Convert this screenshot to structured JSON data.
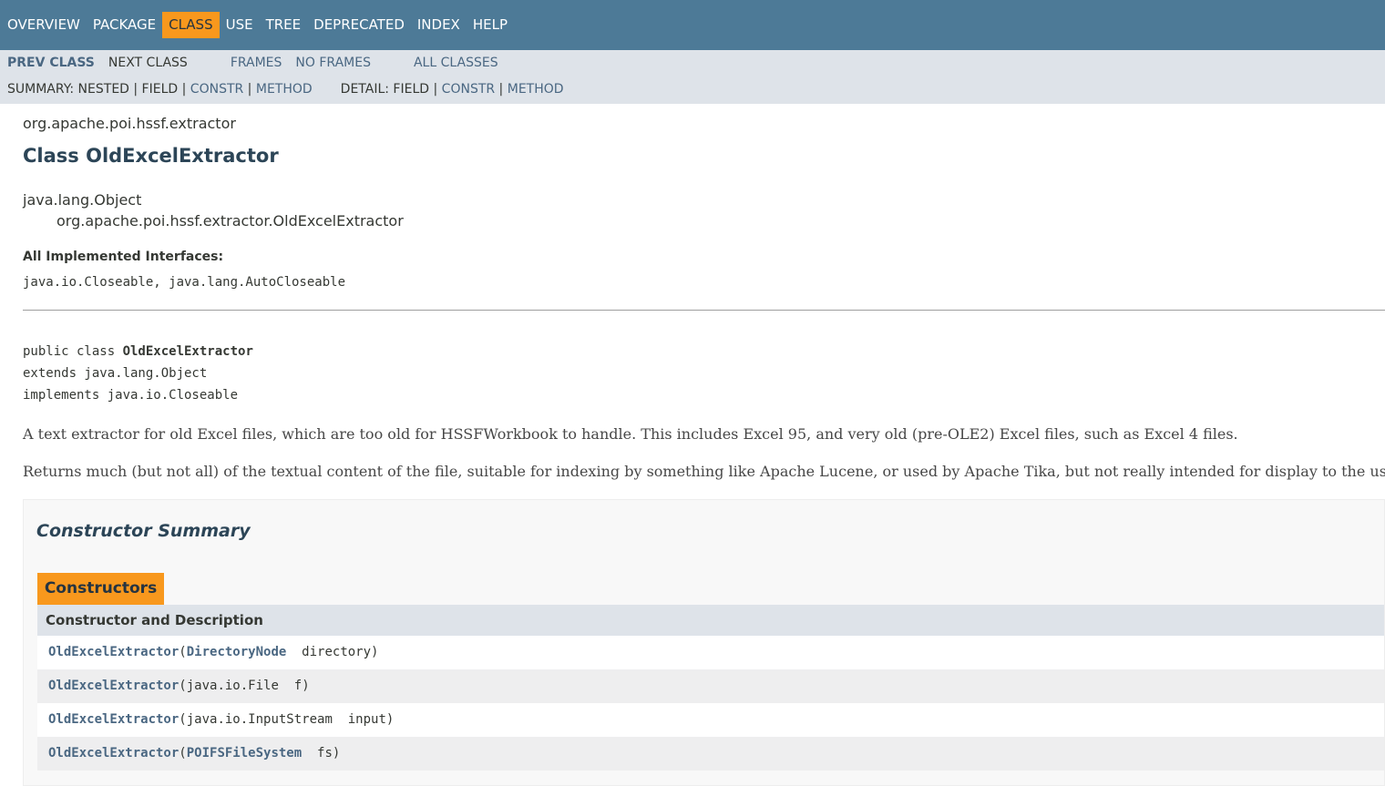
{
  "topnav": {
    "items": [
      {
        "label": "OVERVIEW",
        "active": false
      },
      {
        "label": "PACKAGE",
        "active": false
      },
      {
        "label": "CLASS",
        "active": true
      },
      {
        "label": "USE",
        "active": false
      },
      {
        "label": "TREE",
        "active": false
      },
      {
        "label": "DEPRECATED",
        "active": false
      },
      {
        "label": "INDEX",
        "active": false
      },
      {
        "label": "HELP",
        "active": false
      }
    ]
  },
  "subnav": {
    "prev_class": "PREV CLASS",
    "next_class": "NEXT CLASS",
    "frames": "FRAMES",
    "no_frames": "NO FRAMES",
    "all_classes": "ALL CLASSES",
    "summary_prefix": "SUMMARY: NESTED | FIELD | ",
    "summary_constr": "CONSTR",
    "summary_sep": " | ",
    "summary_method": "METHOD",
    "detail_prefix": "DETAIL: FIELD | ",
    "detail_constr": "CONSTR",
    "detail_sep": " | ",
    "detail_method": "METHOD"
  },
  "header": {
    "package": "org.apache.poi.hssf.extractor",
    "title": "Class OldExcelExtractor"
  },
  "inheritance": {
    "parent": "java.lang.Object",
    "child": "org.apache.poi.hssf.extractor.OldExcelExtractor"
  },
  "interfaces": {
    "label": "All Implemented Interfaces:",
    "list": "java.io.Closeable, java.lang.AutoCloseable"
  },
  "signature": {
    "line1_prefix": "public class ",
    "line1_class": "OldExcelExtractor",
    "line2": "extends java.lang.Object",
    "line3": "implements java.io.Closeable"
  },
  "description": {
    "p1": "A text extractor for old Excel files, which are too old for HSSFWorkbook to handle. This includes Excel 95, and very old (pre-OLE2) Excel files, such as Excel 4 files.",
    "p2": "Returns much (but not all) of the textual content of the file, suitable for indexing by something like Apache Lucene, or used by Apache Tika, but not really intended for display to the user."
  },
  "constructor_summary": {
    "title": "Constructor Summary",
    "tab": "Constructors",
    "column_header": "Constructor and Description",
    "rows": [
      {
        "name": "OldExcelExtractor",
        "open": "(",
        "ptype": "DirectoryNode",
        "ptype_link": true,
        "pname": "directory",
        "close": ")"
      },
      {
        "name": "OldExcelExtractor",
        "open": "(",
        "ptype": "java.io.File",
        "ptype_link": false,
        "pname": "f",
        "close": ")"
      },
      {
        "name": "OldExcelExtractor",
        "open": "(",
        "ptype": "java.io.InputStream",
        "ptype_link": false,
        "pname": "input",
        "close": ")"
      },
      {
        "name": "OldExcelExtractor",
        "open": "(",
        "ptype": "POIFSFileSystem",
        "ptype_link": true,
        "pname": "fs",
        "close": ")"
      }
    ]
  },
  "colors": {
    "topnav_bg": "#4d7a97",
    "active_tab": "#f8981d",
    "subnav_bg": "#dee3e9",
    "link": "#4a6782",
    "title": "#2c4557"
  }
}
